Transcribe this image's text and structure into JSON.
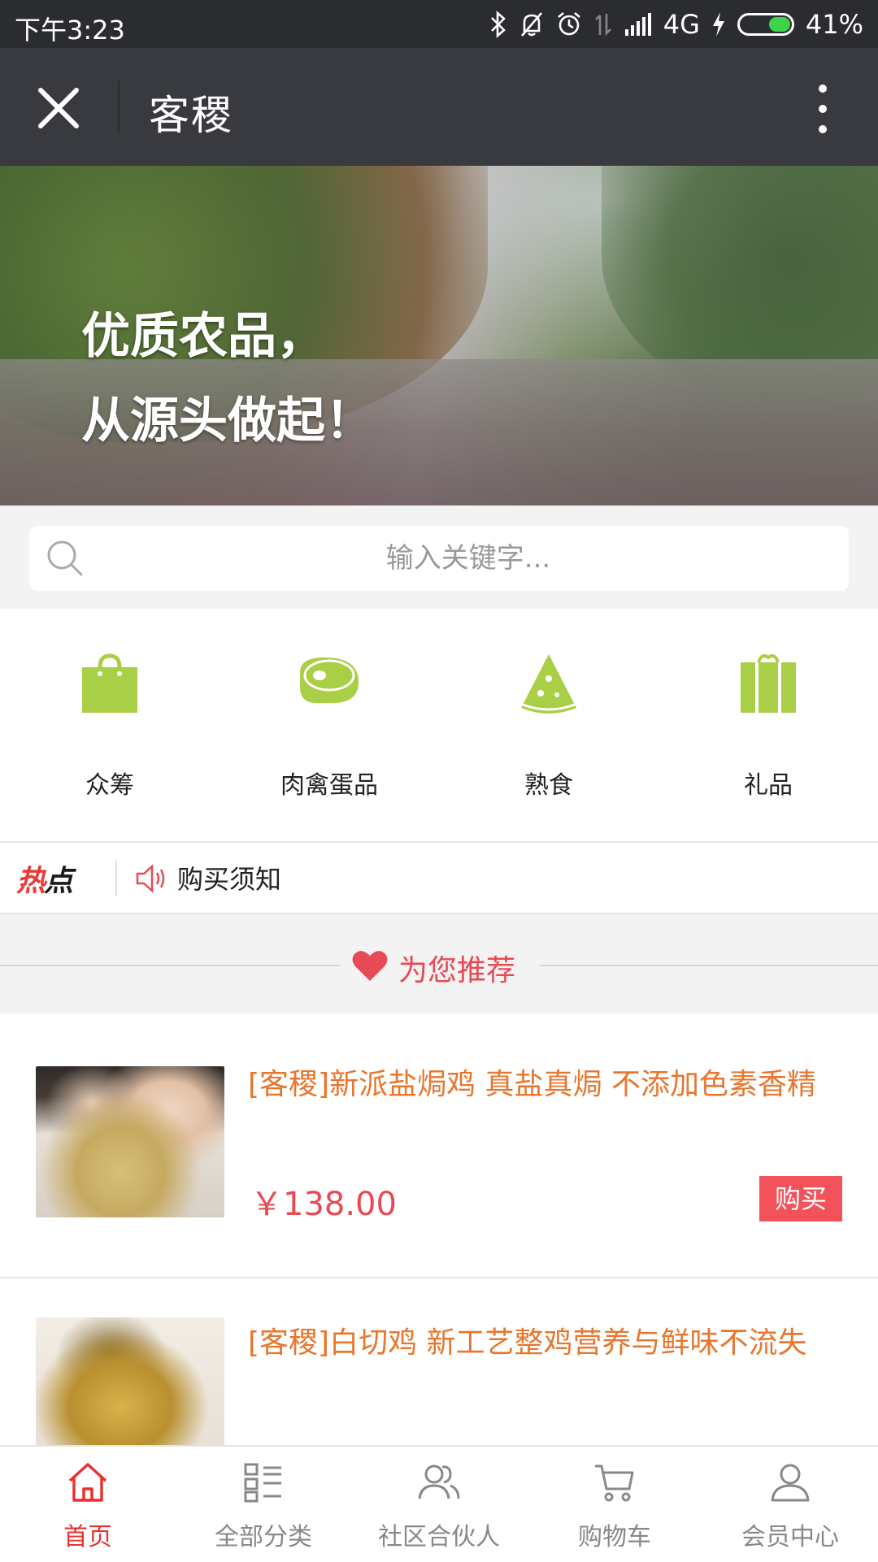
{
  "status_bar": {
    "time": "下午3:23",
    "network": "4G",
    "battery_text": "41%",
    "battery_level": 0.41
  },
  "title_bar": {
    "title": "客稷"
  },
  "banner": {
    "slogan_line1": "优质农品，",
    "slogan_line2": "从源头做起！"
  },
  "search": {
    "placeholder": "输入关键字..."
  },
  "categories": [
    {
      "label": "众筹",
      "icon": "shopping-bag-icon"
    },
    {
      "label": "肉禽蛋品",
      "icon": "meat-icon"
    },
    {
      "label": "熟食",
      "icon": "pizza-slice-icon"
    },
    {
      "label": "礼品",
      "icon": "gift-icon"
    }
  ],
  "hot": {
    "badge_part1": "热",
    "badge_part2": "点",
    "notice": "购买须知"
  },
  "recommend": {
    "title": "为您推荐"
  },
  "products": [
    {
      "name": "[客稷]新派盐焗鸡 真盐真焗 不添加色素香精",
      "price": "￥138.00",
      "buy_label": "购买"
    },
    {
      "name": "[客稷]白切鸡 新工艺整鸡营养与鲜味不流失"
    }
  ],
  "tabbar": [
    {
      "label": "首页",
      "icon": "home-icon",
      "active": true
    },
    {
      "label": "全部分类",
      "icon": "category-list-icon"
    },
    {
      "label": "社区合伙人",
      "icon": "partners-icon"
    },
    {
      "label": "购物车",
      "icon": "cart-icon"
    },
    {
      "label": "会员中心",
      "icon": "user-icon"
    }
  ],
  "colors": {
    "accent": "#e84a55",
    "icon_green": "#a8cf45",
    "product_name": "#e8762d",
    "tab_active": "#e8312f"
  }
}
